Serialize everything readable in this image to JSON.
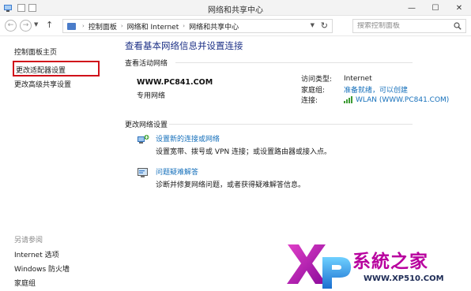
{
  "window": {
    "title": "网络和共享中心"
  },
  "titlebar": {
    "minimize": "—",
    "maximize": "☐",
    "close": "✕"
  },
  "address": {
    "crumbs": [
      "控制面板",
      "网络和 Internet",
      "网络和共享中心"
    ],
    "search_placeholder": "搜索控制面板"
  },
  "left_pane": {
    "home": "控制面板主页",
    "adapter_settings": "更改适配器设置",
    "advanced_sharing": "更改高级共享设置",
    "see_also": "另请参阅",
    "internet_options": "Internet 选项",
    "firewall": "Windows 防火墙",
    "homegroup": "家庭组"
  },
  "main": {
    "title": "查看基本网络信息并设置连接",
    "active_networks_header": "查看活动网络",
    "network_name": "WWW.PC841.COM",
    "network_type": "专用网络",
    "props": [
      {
        "label": "访问类型:",
        "value": "Internet",
        "link": false
      },
      {
        "label": "家庭组:",
        "value": "准备就绪，可以创建",
        "link": true
      },
      {
        "label": "连接:",
        "value": "WLAN (WWW.PC841.COM)",
        "link": true
      }
    ],
    "change_settings_header": "更改网络设置",
    "tasks": [
      {
        "link": "设置新的连接或网络",
        "desc": "设置宽带、拨号或 VPN 连接；或设置路由器或接入点。"
      },
      {
        "link": "问题疑难解答",
        "desc": "诊断并修复网络问题，或者获得疑难解答信息。"
      }
    ]
  },
  "watermark": {
    "text": "系統之家",
    "url": "WWW.XP510.COM"
  },
  "colors": {
    "link": "#1670bb",
    "title": "#1e3287",
    "highlight": "#d0101a",
    "watermark": "#b8009e"
  }
}
